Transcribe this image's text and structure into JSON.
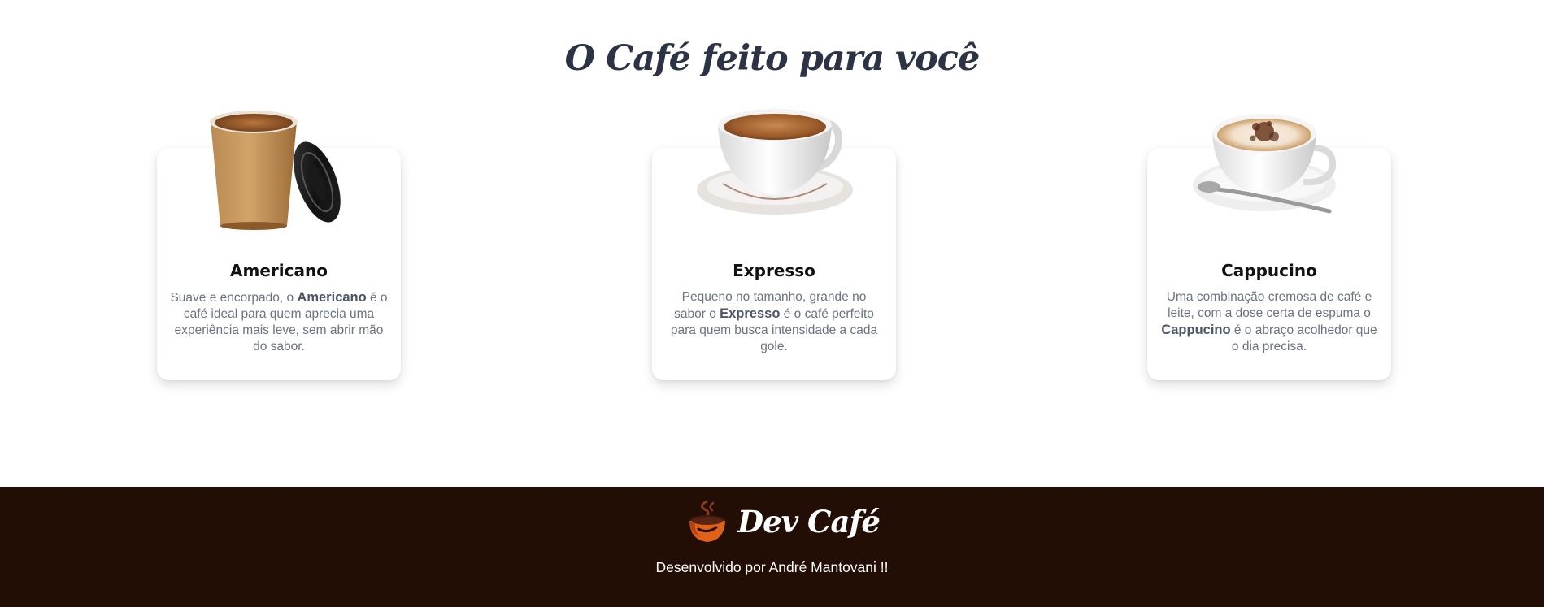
{
  "section": {
    "title": "O Café feito para você"
  },
  "cards": [
    {
      "name": "Americano",
      "desc_before": "Suave e encorpado, o ",
      "desc_bold": "Americano",
      "desc_after": " é o café ideal para quem aprecia uma experiência mais leve, sem abrir mão do sabor.",
      "image_icon": "paper-coffee-cup-with-lid-image"
    },
    {
      "name": "Expresso",
      "desc_before": "Pequeno no tamanho, grande no sabor o ",
      "desc_bold": "Expresso",
      "desc_after": " é o café perfeito para quem busca intensidade a cada gole.",
      "image_icon": "espresso-cup-on-saucer-image"
    },
    {
      "name": "Cappucino",
      "desc_before": "Uma combinação cremosa de café e leite, com a dose certa de espuma o ",
      "desc_bold": "Cappucino",
      "desc_after": " é o abraço acolhedor que o dia precisa.",
      "image_icon": "cappuccino-cup-with-spoon-image"
    }
  ],
  "footer": {
    "brand": "Dev Café",
    "credit": "Desenvolvido por André Mantovani !!",
    "logo_icon": "coffee-cup-logo-icon"
  },
  "colors": {
    "title": "#2b3345",
    "card_text": "#6b7280",
    "footer_bg": "#230e06",
    "footer_text": "#ffffff",
    "logo_orange": "#e0611a"
  }
}
